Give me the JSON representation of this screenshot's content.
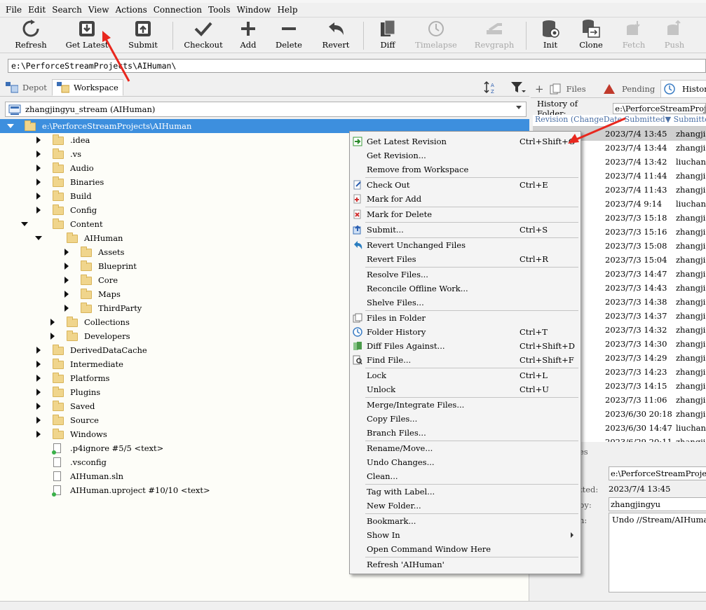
{
  "menubar": {
    "items": [
      "File",
      "Edit",
      "Search",
      "View",
      "Actions",
      "Connection",
      "Tools",
      "Window",
      "Help"
    ]
  },
  "toolbar": {
    "buttons": [
      {
        "label": "Refresh",
        "icon": "refresh-icon",
        "enabled": true
      },
      {
        "label": "Get Latest",
        "icon": "get-latest-icon",
        "enabled": true
      },
      {
        "label": "Submit",
        "icon": "submit-icon",
        "enabled": true
      },
      {
        "label": "Checkout",
        "icon": "checkmark-icon",
        "enabled": true
      },
      {
        "label": "Add",
        "icon": "plus-icon",
        "enabled": true
      },
      {
        "label": "Delete",
        "icon": "minus-icon",
        "enabled": true
      },
      {
        "label": "Revert",
        "icon": "revert-icon",
        "enabled": true
      },
      {
        "label": "Diff",
        "icon": "diff-icon",
        "enabled": true
      },
      {
        "label": "Timelapse",
        "icon": "timelapse-icon",
        "enabled": false
      },
      {
        "label": "Revgraph",
        "icon": "revgraph-icon",
        "enabled": false
      },
      {
        "label": "Init",
        "icon": "init-icon",
        "enabled": true
      },
      {
        "label": "Clone",
        "icon": "clone-icon",
        "enabled": true
      },
      {
        "label": "Fetch",
        "icon": "fetch-icon",
        "enabled": false
      },
      {
        "label": "Push",
        "icon": "push-icon",
        "enabled": false
      }
    ]
  },
  "address": {
    "value": "e:\\PerforceStreamProjects\\AIHuman\\"
  },
  "left_tabs": {
    "depot": "Depot",
    "workspace": "Workspace"
  },
  "workspace_selector": {
    "value": "zhangjingyu_stream (AIHuman)"
  },
  "tree": {
    "rows": [
      {
        "label": "e:\\PerforceStreamProjects\\AIHuman",
        "type": "folder"
      },
      {
        "label": ".idea",
        "type": "folder"
      },
      {
        "label": ".vs",
        "type": "folder"
      },
      {
        "label": "Audio",
        "type": "folder"
      },
      {
        "label": "Binaries",
        "type": "folder"
      },
      {
        "label": "Build",
        "type": "folder"
      },
      {
        "label": "Config",
        "type": "folder"
      },
      {
        "label": "Content",
        "type": "folder"
      },
      {
        "label": "AIHuman",
        "type": "folder"
      },
      {
        "label": "Assets",
        "type": "folder"
      },
      {
        "label": "Blueprint",
        "type": "folder"
      },
      {
        "label": "Core",
        "type": "folder"
      },
      {
        "label": "Maps",
        "type": "folder"
      },
      {
        "label": "ThirdParty",
        "type": "folder"
      },
      {
        "label": "Collections",
        "type": "folder"
      },
      {
        "label": "Developers",
        "type": "folder"
      },
      {
        "label": "DerivedDataCache",
        "type": "folder"
      },
      {
        "label": "Intermediate",
        "type": "folder"
      },
      {
        "label": "Platforms",
        "type": "folder"
      },
      {
        "label": "Plugins",
        "type": "folder"
      },
      {
        "label": "Saved",
        "type": "folder"
      },
      {
        "label": "Source",
        "type": "folder"
      },
      {
        "label": "Windows",
        "type": "folder"
      },
      {
        "label": ".p4ignore #5/5 <text>",
        "type": "file-tracked"
      },
      {
        "label": ".vsconfig",
        "type": "file"
      },
      {
        "label": "AIHuman.sln",
        "type": "file"
      },
      {
        "label": "AIHuman.uproject #10/10 <text>",
        "type": "file-tracked"
      }
    ]
  },
  "right_tabs": {
    "files": "Files",
    "pending": "Pending",
    "history": "Histor"
  },
  "history": {
    "header_label": "History of Folder:",
    "header_path": "e:\\PerforceStreamProj",
    "columns": "Revision (ChangeDate Submitted▼ Submitte",
    "rows": [
      {
        "date": "2023/7/4 13:45",
        "user": "zhangji"
      },
      {
        "date": "2023/7/4 13:44",
        "user": "zhangji"
      },
      {
        "date": "2023/7/4 13:42",
        "user": "liuchan"
      },
      {
        "date": "2023/7/4 11:44",
        "user": "zhangji"
      },
      {
        "date": "2023/7/4 11:43",
        "user": "zhangji"
      },
      {
        "date": "2023/7/4 9:14",
        "user": "liuchan"
      },
      {
        "date": "2023/7/3 15:18",
        "user": "zhangji"
      },
      {
        "date": "2023/7/3 15:16",
        "user": "zhangji"
      },
      {
        "date": "2023/7/3 15:08",
        "user": "zhangji"
      },
      {
        "date": "2023/7/3 15:04",
        "user": "zhangji"
      },
      {
        "date": "2023/7/3 14:47",
        "user": "zhangji"
      },
      {
        "date": "2023/7/3 14:43",
        "user": "zhangji"
      },
      {
        "date": "2023/7/3 14:38",
        "user": "zhangji"
      },
      {
        "date": "2023/7/3 14:37",
        "user": "zhangji"
      },
      {
        "date": "2023/7/3 14:32",
        "user": "zhangji"
      },
      {
        "date": "2023/7/3 14:30",
        "user": "zhangji"
      },
      {
        "date": "2023/7/3 14:29",
        "user": "zhangji"
      },
      {
        "date": "2023/7/3 14:23",
        "user": "zhangji"
      },
      {
        "date": "2023/7/3 14:15",
        "user": "zhangji"
      },
      {
        "date": "2023/7/3 11:06",
        "user": "zhangji"
      },
      {
        "date": "2023/6/30 20:18",
        "user": "zhangji"
      },
      {
        "date": "2023/6/30 14:47",
        "user": "liuchan"
      },
      {
        "date": "2023/6/29 20:11",
        "user": "zhangji"
      }
    ]
  },
  "detail": {
    "tab": "es",
    "path_value": "e:\\PerforceStreamProjec",
    "submitted_label": "tted:",
    "submitted_value": "2023/7/4 13:45",
    "by_label": "by:",
    "by_value": "zhangjingyu",
    "desc_label": "n:",
    "desc_value": "Undo //Stream/AIHuman/m"
  },
  "context_menu": {
    "items": [
      {
        "label": "Get Latest Revision",
        "shortcut": "Ctrl+Shift+G",
        "icon": "get-latest-icon"
      },
      {
        "label": "Get Revision...",
        "shortcut": "",
        "icon": ""
      },
      {
        "label": "Remove from Workspace",
        "shortcut": "",
        "icon": ""
      },
      {
        "sep": true
      },
      {
        "label": "Check Out",
        "shortcut": "Ctrl+E",
        "icon": "check-out-icon"
      },
      {
        "label": "Mark for Add",
        "shortcut": "",
        "icon": "mark-add-icon"
      },
      {
        "sep": true
      },
      {
        "label": "Mark for Delete",
        "shortcut": "",
        "icon": "mark-delete-icon"
      },
      {
        "sep": true
      },
      {
        "label": "Submit...",
        "shortcut": "Ctrl+S",
        "icon": "submit-icon"
      },
      {
        "sep": true
      },
      {
        "label": "Revert Unchanged Files",
        "shortcut": "",
        "icon": "revert-icon"
      },
      {
        "label": "Revert Files",
        "shortcut": "Ctrl+R",
        "icon": ""
      },
      {
        "sep": true
      },
      {
        "label": "Resolve Files...",
        "shortcut": "",
        "icon": ""
      },
      {
        "label": "Reconcile Offline Work...",
        "shortcut": "",
        "icon": ""
      },
      {
        "label": "Shelve Files...",
        "shortcut": "",
        "icon": ""
      },
      {
        "sep": true
      },
      {
        "label": "Files in Folder",
        "shortcut": "",
        "icon": "files-icon"
      },
      {
        "label": "Folder History",
        "shortcut": "Ctrl+T",
        "icon": "history-icon"
      },
      {
        "label": "Diff Files Against...",
        "shortcut": "Ctrl+Shift+D",
        "icon": "diff-icon"
      },
      {
        "label": "Find File...",
        "shortcut": "Ctrl+Shift+F",
        "icon": "find-icon"
      },
      {
        "sep": true
      },
      {
        "label": "Lock",
        "shortcut": "Ctrl+L",
        "icon": ""
      },
      {
        "label": "Unlock",
        "shortcut": "Ctrl+U",
        "icon": ""
      },
      {
        "sep": true
      },
      {
        "label": "Merge/Integrate Files...",
        "shortcut": "",
        "icon": ""
      },
      {
        "label": "Copy Files...",
        "shortcut": "",
        "icon": ""
      },
      {
        "label": "Branch Files...",
        "shortcut": "",
        "icon": ""
      },
      {
        "sep": true
      },
      {
        "label": "Rename/Move...",
        "shortcut": "",
        "icon": ""
      },
      {
        "label": "Undo Changes...",
        "shortcut": "",
        "icon": ""
      },
      {
        "label": "Clean...",
        "shortcut": "",
        "icon": ""
      },
      {
        "sep": true
      },
      {
        "label": "Tag with Label...",
        "shortcut": "",
        "icon": ""
      },
      {
        "label": "New Folder...",
        "shortcut": "",
        "icon": ""
      },
      {
        "sep": true
      },
      {
        "label": "Bookmark...",
        "shortcut": "",
        "icon": ""
      },
      {
        "label": "Show In",
        "shortcut": "",
        "icon": "",
        "submenu": true
      },
      {
        "label": "Open Command Window Here",
        "shortcut": "",
        "icon": ""
      },
      {
        "sep": true
      },
      {
        "label": "Refresh 'AIHuman'",
        "shortcut": "",
        "icon": ""
      }
    ]
  },
  "colors": {
    "selection": "#3d8fde",
    "annotation": "#e8271e",
    "folder": "#f0d58c"
  }
}
